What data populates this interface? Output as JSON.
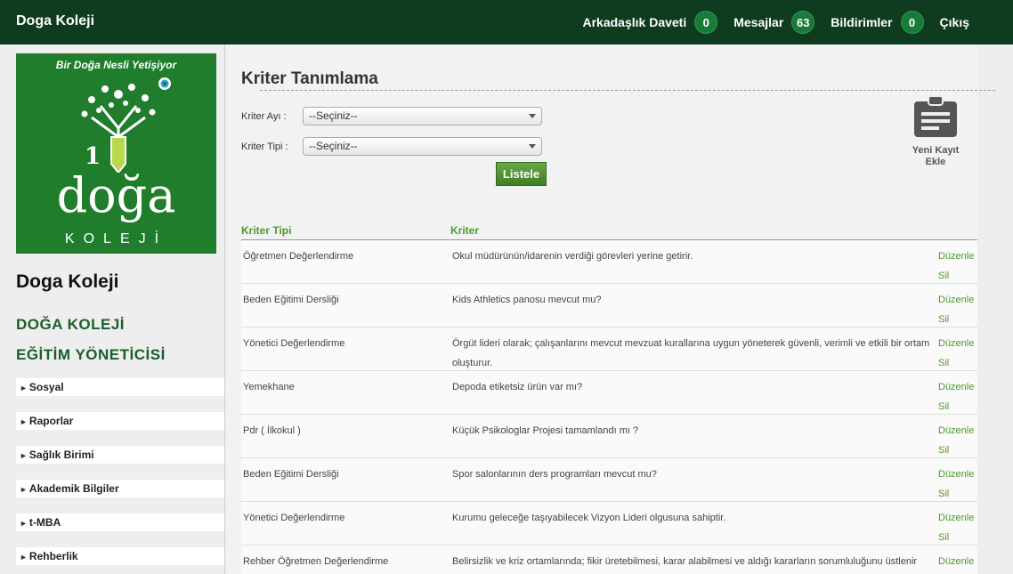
{
  "header": {
    "brand": "Doga Koleji",
    "invites_label": "Arkadaşlık Daveti",
    "invites_count": "0",
    "messages_label": "Mesajlar",
    "messages_count": "63",
    "notifications_label": "Bildirimler",
    "notifications_count": "0",
    "logout_label": "Çıkış"
  },
  "sidebar": {
    "logo_tagline": "Bir Doğa Nesli Yetişiyor",
    "logo_wordmark": "doğa",
    "logo_sub": "KOLEJİ",
    "title": "Doga Koleji",
    "org_line1": "DOĞA KOLEJİ",
    "org_line2": "EĞİTİM YÖNETİCİSİ",
    "items": [
      {
        "label": "Sosyal"
      },
      {
        "label": "Raporlar"
      },
      {
        "label": "Sağlık Birimi"
      },
      {
        "label": "Akademik Bilgiler"
      },
      {
        "label": "t-MBA"
      },
      {
        "label": "Rehberlik"
      }
    ]
  },
  "main": {
    "title": "Kriter Tanımlama",
    "month_label": "Kriter Ayı",
    "month_value": "--Seçiniz--",
    "type_label": "Kriter Tipi",
    "type_value": "--Seçiniz--",
    "list_button": "Listele",
    "new_record_label": "Yeni Kayıt Ekle",
    "colon": ":",
    "table": {
      "col_type": "Kriter Tipi",
      "col_criterion": "Kriter",
      "edit_label": "Düzenle",
      "delete_label": "Sil",
      "rows": [
        {
          "type": "Öğretmen Değerlendirme",
          "criterion": "Okul müdürünün/idarenin verdiği görevleri yerine getirir."
        },
        {
          "type": "Beden Eğitimi Dersliği",
          "criterion": "Kids Athletics panosu mevcut mu?"
        },
        {
          "type": "Yönetici Değerlendirme",
          "criterion": "Örgüt lideri olarak; çalışanlarını mevcut mevzuat kurallarına uygun yöneterek güvenli, verimli ve etkili bir ortam oluşturur."
        },
        {
          "type": "Yemekhane",
          "criterion": "Depoda etiketsiz ürün var mı?"
        },
        {
          "type": "Pdr ( İlkokul )",
          "criterion": "Küçük Psikologlar Projesi tamamlandı mı ?"
        },
        {
          "type": "Beden Eğitimi Dersliği",
          "criterion": "Spor salonlarının ders programları mevcut mu?"
        },
        {
          "type": "Yönetici Değerlendirme",
          "criterion": "Kurumu geleceğe taşıyabilecek Vizyon Lideri olgusuna sahiptir."
        },
        {
          "type": "Rehber Öğretmen Değerlendirme",
          "criterion": "Belirsizlik ve kriz ortamlarında; fikir üretebilmesi, karar alabilmesi ve aldığı kararların sorumluluğunu üstlenir mi?."
        }
      ]
    }
  },
  "colors": {
    "topbar": "#0f3b1f",
    "badge": "#1b7a3a",
    "accent_green": "#4c9a2a",
    "logo_green": "#1f7d2c"
  }
}
